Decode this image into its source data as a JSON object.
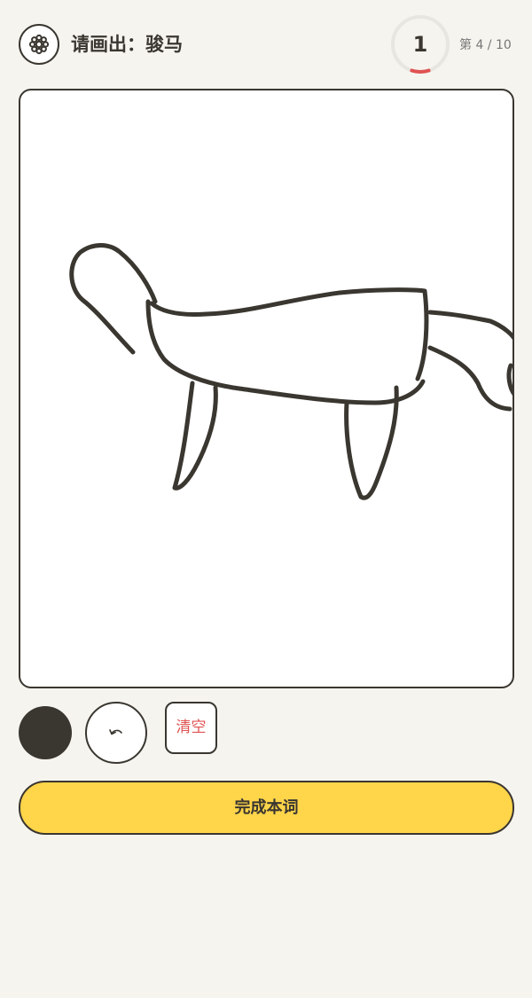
{
  "header": {
    "title": "请画出：骏马",
    "timer_value": "1",
    "round_text": "第 4 / 10",
    "timer_remaining_fraction": 0.1
  },
  "tools": {
    "brush_color": "#3a3630",
    "undo_icon": "undo-icon",
    "clear_label": "清空"
  },
  "actions": {
    "done_label": "完成本词"
  },
  "colors": {
    "accent": "#ffd54a",
    "ink": "#3a3630",
    "danger": "#e05252",
    "background": "#f6f4ef"
  }
}
